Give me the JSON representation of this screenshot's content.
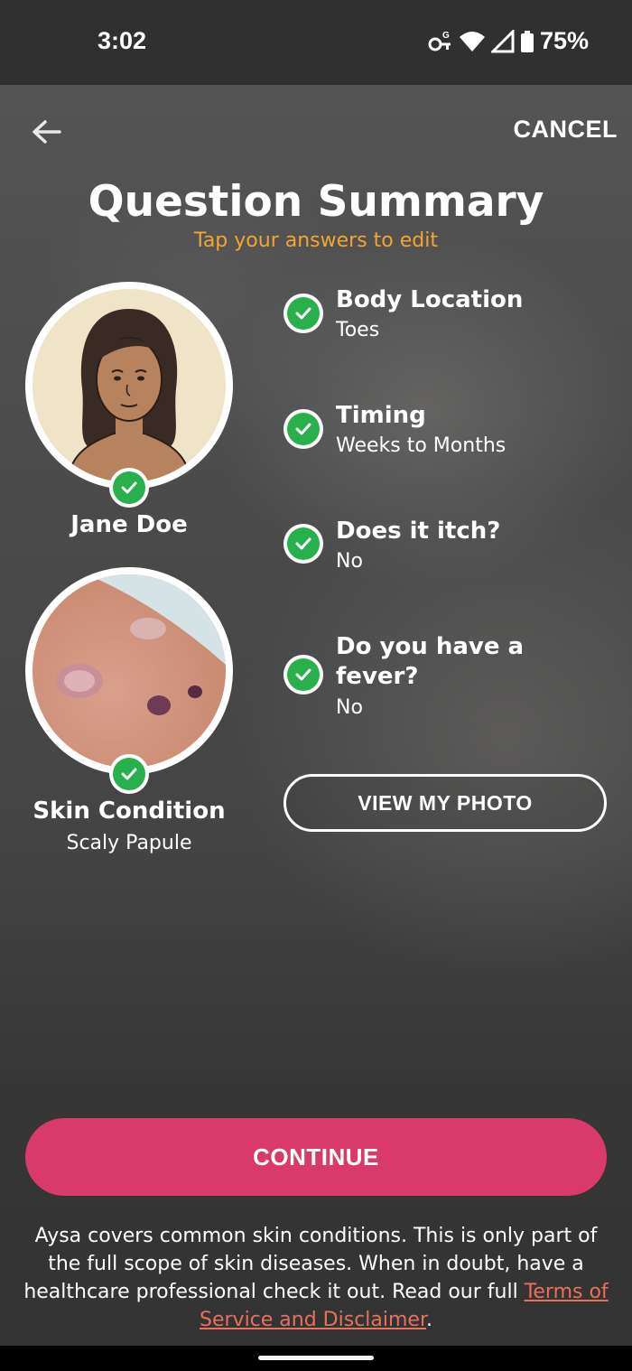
{
  "status_bar": {
    "time": "3:02",
    "battery": "75%",
    "icons": [
      "vpn-key-icon",
      "wifi-icon",
      "cellular-signal-icon",
      "battery-icon"
    ]
  },
  "header": {
    "back_icon": "arrow-left-icon",
    "cancel_label": "CANCEL",
    "title": "Question Summary",
    "subtitle": "Tap your answers to edit"
  },
  "profile": {
    "name": "Jane Doe"
  },
  "skin_condition": {
    "label": "Skin Condition",
    "value": "Scaly Papule"
  },
  "answers": [
    {
      "question": "Body Location",
      "answer": "Toes"
    },
    {
      "question": "Timing",
      "answer": "Weeks to Months"
    },
    {
      "question": "Does it itch?",
      "answer": "No"
    },
    {
      "question": "Do you have a fever?",
      "answer": "No"
    }
  ],
  "buttons": {
    "view_photo": "VIEW MY PHOTO",
    "continue": "CONTINUE"
  },
  "disclaimer": {
    "text": "Aysa covers common skin conditions. This is only part of the full scope of skin diseases. When in doubt, have a healthcare professional check it out. Read our full ",
    "link": "Terms of Service and Disclaimer",
    "end": "."
  },
  "colors": {
    "accent_orange": "#f3a531",
    "continue_pink": "#d93a6b",
    "check_green": "#27b04b",
    "link": "#e8715a"
  }
}
